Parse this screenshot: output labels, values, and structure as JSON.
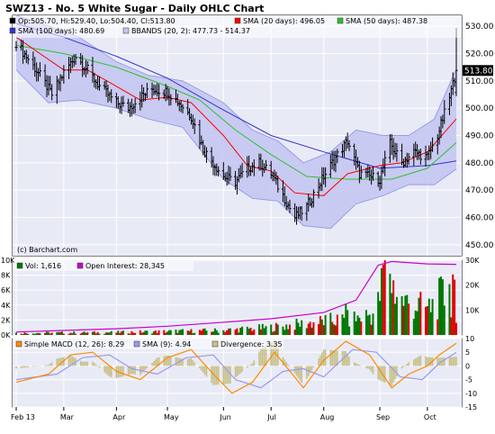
{
  "title": "SWZ13 - No. 5 White Sugar - Daily OHLC Chart",
  "colors": {
    "background": "#e8ebf6",
    "grid": "#ffffff",
    "bars": "#000000",
    "sma20": "#ff0000",
    "sma50": "#2fbf2f",
    "sma100": "#3333cc",
    "bbands_fill": "#c4c6f2",
    "bbands_line": "#9a9ce6",
    "last_price_bg": "#000000",
    "volume_up": "#007700",
    "volume_down": "#dd0000",
    "open_interest": "#cc00cc",
    "macd_fast": "#ff8800",
    "macd_signal": "#9999ee",
    "divergence": "#c8c08a"
  },
  "chart_data": [
    {
      "panel": "price",
      "type": "ohlc",
      "legend": {
        "ohlc": "Op:505.70, Hi:529.40, Lo:504.40, Cl:513.80",
        "sma20": "SMA (20 days): 496.05",
        "sma50": "SMA (50 days): 487.38",
        "sma100": "SMA (100 days): 480.69",
        "bbands": "BBANDS (20, 2): 477.73 - 514.37"
      },
      "last_price_label": "513.80",
      "credit": "(c) Barchart.com",
      "ylim": [
        446,
        534
      ],
      "yticks": [
        450,
        460,
        470,
        480,
        490,
        500,
        510,
        520,
        530
      ],
      "ytick_labels": [
        "450.00",
        "460.00",
        "470.00",
        "480.00",
        "490.00",
        "500.00",
        "510.00",
        "520.00",
        "530.00"
      ],
      "x_start": "2013-02-01",
      "x_end": "2013-10-18",
      "x_month_ticks": [
        {
          "date": "2013-02-01",
          "label": "Feb 13"
        },
        {
          "date": "2013-03-01",
          "label": "Mar"
        },
        {
          "date": "2013-04-01",
          "label": "Apr"
        },
        {
          "date": "2013-05-01",
          "label": "May"
        },
        {
          "date": "2013-06-03",
          "label": "Jun"
        },
        {
          "date": "2013-07-01",
          "label": "Jul"
        },
        {
          "date": "2013-08-01",
          "label": "Aug"
        },
        {
          "date": "2013-09-03",
          "label": "Sep"
        },
        {
          "date": "2013-10-01",
          "label": "Oct"
        }
      ],
      "close_profile": [
        [
          "2013-02-01",
          524
        ],
        [
          "2013-02-08",
          518
        ],
        [
          "2013-02-15",
          512
        ],
        [
          "2013-02-22",
          505
        ],
        [
          "2013-03-01",
          513
        ],
        [
          "2013-03-08",
          519
        ],
        [
          "2013-03-15",
          514
        ],
        [
          "2013-03-22",
          508
        ],
        [
          "2013-04-01",
          502
        ],
        [
          "2013-04-08",
          500
        ],
        [
          "2013-04-15",
          504
        ],
        [
          "2013-04-22",
          507
        ],
        [
          "2013-05-01",
          506
        ],
        [
          "2013-05-08",
          502
        ],
        [
          "2013-05-15",
          497
        ],
        [
          "2013-05-22",
          485
        ],
        [
          "2013-06-03",
          475
        ],
        [
          "2013-06-10",
          473
        ],
        [
          "2013-06-17",
          478
        ],
        [
          "2013-06-24",
          480
        ],
        [
          "2013-07-01",
          476
        ],
        [
          "2013-07-08",
          468
        ],
        [
          "2013-07-15",
          460
        ],
        [
          "2013-07-22",
          464
        ],
        [
          "2013-08-01",
          475
        ],
        [
          "2013-08-08",
          482
        ],
        [
          "2013-08-15",
          488
        ],
        [
          "2013-08-22",
          476
        ],
        [
          "2013-09-03",
          474
        ],
        [
          "2013-09-09",
          487
        ],
        [
          "2013-09-16",
          480
        ],
        [
          "2013-09-23",
          484
        ],
        [
          "2013-10-01",
          482
        ],
        [
          "2013-10-07",
          490
        ],
        [
          "2013-10-14",
          504
        ],
        [
          "2013-10-18",
          513.8
        ]
      ],
      "sma20": [
        [
          "2013-02-01",
          526
        ],
        [
          "2013-02-15",
          520
        ],
        [
          "2013-03-01",
          514
        ],
        [
          "2013-03-15",
          514
        ],
        [
          "2013-04-01",
          508
        ],
        [
          "2013-04-15",
          503
        ],
        [
          "2013-05-01",
          504
        ],
        [
          "2013-05-15",
          502
        ],
        [
          "2013-06-03",
          490
        ],
        [
          "2013-06-17",
          479
        ],
        [
          "2013-07-01",
          477
        ],
        [
          "2013-07-15",
          469
        ],
        [
          "2013-08-01",
          468
        ],
        [
          "2013-08-15",
          476
        ],
        [
          "2013-09-03",
          479
        ],
        [
          "2013-09-16",
          480
        ],
        [
          "2013-10-01",
          484
        ],
        [
          "2013-10-18",
          496.05
        ]
      ],
      "sma50": [
        [
          "2013-02-01",
          523
        ],
        [
          "2013-03-01",
          520
        ],
        [
          "2013-04-01",
          515
        ],
        [
          "2013-05-01",
          508
        ],
        [
          "2013-05-20",
          503
        ],
        [
          "2013-06-10",
          492
        ],
        [
          "2013-07-01",
          483
        ],
        [
          "2013-07-22",
          475
        ],
        [
          "2013-08-15",
          474
        ],
        [
          "2013-09-10",
          474
        ],
        [
          "2013-10-01",
          478
        ],
        [
          "2013-10-18",
          487.38
        ]
      ],
      "sma100": [
        [
          "2013-02-01",
          531
        ],
        [
          "2013-03-01",
          526
        ],
        [
          "2013-04-01",
          519
        ],
        [
          "2013-05-01",
          511
        ],
        [
          "2013-06-01",
          500
        ],
        [
          "2013-07-01",
          490
        ],
        [
          "2013-08-01",
          484
        ],
        [
          "2013-09-03",
          478
        ],
        [
          "2013-10-01",
          479
        ],
        [
          "2013-10-18",
          480.69
        ]
      ],
      "bb_upper": [
        [
          "2013-02-01",
          534
        ],
        [
          "2013-02-20",
          530
        ],
        [
          "2013-03-10",
          526
        ],
        [
          "2013-04-01",
          517
        ],
        [
          "2013-04-20",
          512
        ],
        [
          "2013-05-10",
          510
        ],
        [
          "2013-06-03",
          502
        ],
        [
          "2013-06-20",
          492
        ],
        [
          "2013-07-05",
          488
        ],
        [
          "2013-07-20",
          480
        ],
        [
          "2013-08-05",
          484
        ],
        [
          "2013-08-20",
          492
        ],
        [
          "2013-09-05",
          490
        ],
        [
          "2013-09-20",
          490
        ],
        [
          "2013-10-05",
          496
        ],
        [
          "2013-10-18",
          514.37
        ]
      ],
      "bb_lower": [
        [
          "2013-02-01",
          514
        ],
        [
          "2013-02-20",
          502
        ],
        [
          "2013-03-10",
          503
        ],
        [
          "2013-04-01",
          500
        ],
        [
          "2013-04-20",
          496
        ],
        [
          "2013-05-10",
          493
        ],
        [
          "2013-06-03",
          474
        ],
        [
          "2013-06-20",
          467
        ],
        [
          "2013-07-05",
          466
        ],
        [
          "2013-07-20",
          457
        ],
        [
          "2013-08-05",
          456
        ],
        [
          "2013-08-20",
          465
        ],
        [
          "2013-09-05",
          468
        ],
        [
          "2013-09-20",
          472
        ],
        [
          "2013-10-05",
          472
        ],
        [
          "2013-10-18",
          477.73
        ]
      ]
    },
    {
      "panel": "volume",
      "type": "bar",
      "legend": {
        "volume": "Vol: 1,616",
        "open_interest": "Open Interest: 28,345"
      },
      "ylim": [
        0,
        10000
      ],
      "yticks": [
        0,
        2000,
        4000,
        6000,
        8000,
        10000
      ],
      "ytick_labels": [
        "0K",
        "2K",
        "4K",
        "6K",
        "8K",
        "10K"
      ],
      "oi_ylim": [
        0,
        30000
      ],
      "oi_yticks": [
        10000,
        20000,
        30000
      ],
      "oi_ytick_labels": [
        "10K",
        "20K",
        "30K"
      ],
      "volume_profile": [
        [
          "2013-02-01",
          250
        ],
        [
          "2013-04-01",
          350
        ],
        [
          "2013-06-01",
          600
        ],
        [
          "2013-07-01",
          1000
        ],
        [
          "2013-08-01",
          1800
        ],
        [
          "2013-08-20",
          2200
        ],
        [
          "2013-09-01",
          3000
        ],
        [
          "2013-09-06",
          8500
        ],
        [
          "2013-09-16",
          4500
        ],
        [
          "2013-10-01",
          3500
        ],
        [
          "2013-10-10",
          5200
        ],
        [
          "2013-10-18",
          1616
        ]
      ],
      "volume_spikes": [
        [
          "2013-08-14",
          4200
        ],
        [
          "2013-09-05",
          9400
        ],
        [
          "2013-09-09",
          8200
        ],
        [
          "2013-10-14",
          6800
        ],
        [
          "2013-10-16",
          8100
        ],
        [
          "2013-10-17",
          7400
        ]
      ],
      "open_interest": [
        [
          "2013-02-01",
          1200
        ],
        [
          "2013-03-01",
          1800
        ],
        [
          "2013-04-01",
          2500
        ],
        [
          "2013-05-01",
          3500
        ],
        [
          "2013-06-01",
          5000
        ],
        [
          "2013-07-01",
          6500
        ],
        [
          "2013-08-01",
          9000
        ],
        [
          "2013-08-20",
          14000
        ],
        [
          "2013-09-02",
          28000
        ],
        [
          "2013-09-10",
          29500
        ],
        [
          "2013-10-01",
          28500
        ],
        [
          "2013-10-18",
          28345
        ]
      ]
    },
    {
      "panel": "macd",
      "type": "line",
      "legend": {
        "macd": "Simple MACD (12, 26): 8.29",
        "signal": "SMA (9): 4.94",
        "divergence": "Divergence: 3.35"
      },
      "ylim": [
        -15,
        10
      ],
      "yticks": [
        -15,
        -10,
        -5,
        0,
        5,
        10
      ],
      "ytick_labels": [
        "-15",
        "-10",
        "-5",
        "0",
        "5",
        "10"
      ],
      "macd": [
        [
          "2013-02-01",
          -6
        ],
        [
          "2013-02-20",
          -3
        ],
        [
          "2013-03-05",
          4
        ],
        [
          "2013-03-18",
          5
        ],
        [
          "2013-04-01",
          -2
        ],
        [
          "2013-04-15",
          -5
        ],
        [
          "2013-05-01",
          3
        ],
        [
          "2013-05-15",
          6
        ],
        [
          "2013-05-28",
          -3
        ],
        [
          "2013-06-08",
          -10
        ],
        [
          "2013-06-20",
          -6
        ],
        [
          "2013-07-03",
          5
        ],
        [
          "2013-07-20",
          -8
        ],
        [
          "2013-08-01",
          2
        ],
        [
          "2013-08-14",
          9
        ],
        [
          "2013-08-28",
          4
        ],
        [
          "2013-09-10",
          -8
        ],
        [
          "2013-09-20",
          -3
        ],
        [
          "2013-10-01",
          0
        ],
        [
          "2013-10-08",
          4
        ],
        [
          "2013-10-18",
          8.29
        ]
      ],
      "signal": [
        [
          "2013-02-01",
          -5
        ],
        [
          "2013-02-25",
          -3
        ],
        [
          "2013-03-12",
          3
        ],
        [
          "2013-03-28",
          4
        ],
        [
          "2013-04-10",
          -1
        ],
        [
          "2013-04-25",
          -3
        ],
        [
          "2013-05-12",
          3
        ],
        [
          "2013-05-28",
          4
        ],
        [
          "2013-06-10",
          -5
        ],
        [
          "2013-06-25",
          -8
        ],
        [
          "2013-07-08",
          -2
        ],
        [
          "2013-07-20",
          -1
        ],
        [
          "2013-08-01",
          -4
        ],
        [
          "2013-08-18",
          6
        ],
        [
          "2013-09-01",
          5
        ],
        [
          "2013-09-15",
          -4
        ],
        [
          "2013-09-28",
          -5
        ],
        [
          "2013-10-08",
          1
        ],
        [
          "2013-10-18",
          4.94
        ]
      ]
    }
  ]
}
